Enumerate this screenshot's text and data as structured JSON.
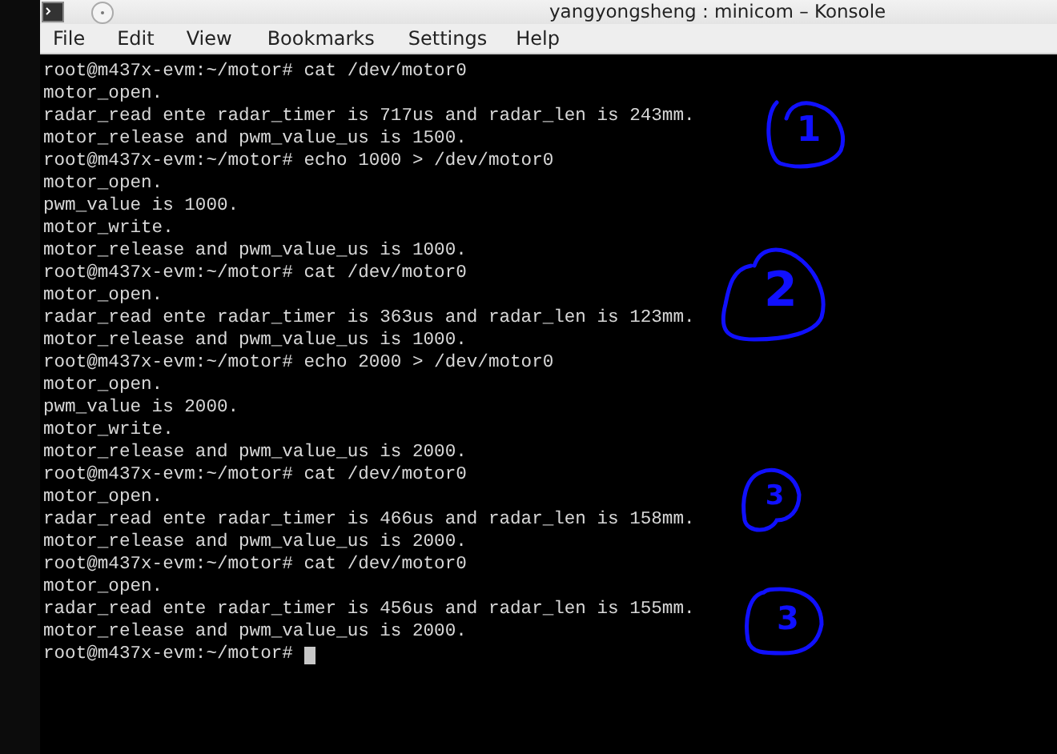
{
  "window": {
    "title": "yangyongsheng : minicom – Konsole"
  },
  "menu": [
    "File",
    "Edit",
    "View",
    "Bookmarks",
    "Settings",
    "Help"
  ],
  "terminal": {
    "lines": [
      "root@m437x-evm:~/motor# cat /dev/motor0",
      "motor_open.",
      "radar_read ente radar_timer is 717us and radar_len is 243mm.",
      "motor_release and pwm_value_us is 1500.",
      "root@m437x-evm:~/motor# echo 1000 > /dev/motor0",
      "motor_open.",
      "pwm_value is 1000.",
      "motor_write.",
      "motor_release and pwm_value_us is 1000.",
      "root@m437x-evm:~/motor# cat /dev/motor0",
      "motor_open.",
      "radar_read ente radar_timer is 363us and radar_len is 123mm.",
      "motor_release and pwm_value_us is 1000.",
      "root@m437x-evm:~/motor# echo 2000 > /dev/motor0",
      "motor_open.",
      "pwm_value is 2000.",
      "motor_write.",
      "motor_release and pwm_value_us is 2000.",
      "root@m437x-evm:~/motor# cat /dev/motor0",
      "motor_open.",
      "radar_read ente radar_timer is 466us and radar_len is 158mm.",
      "motor_release and pwm_value_us is 2000.",
      "root@m437x-evm:~/motor# cat /dev/motor0",
      "motor_open.",
      "radar_read ente radar_timer is 456us and radar_len is 155mm.",
      "motor_release and pwm_value_us is 2000.",
      "root@m437x-evm:~/motor# "
    ],
    "cursor": true
  },
  "annotations": [
    {
      "label": "1"
    },
    {
      "label": "2"
    },
    {
      "label": "3"
    },
    {
      "label": "3"
    }
  ]
}
